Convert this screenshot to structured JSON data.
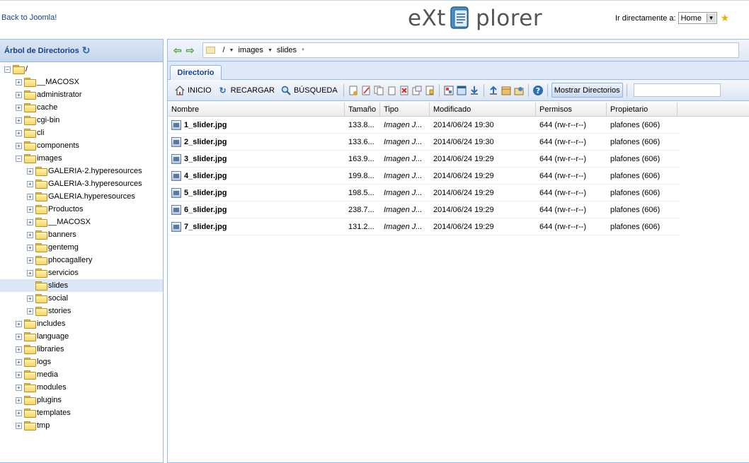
{
  "header": {
    "back_link": "Back to Joomla!",
    "logo_left": "eXt",
    "logo_right": "plorer",
    "jump_label": "Ir directamente a:",
    "jump_value": "Home"
  },
  "tree": {
    "title": "Árbol de Directorios",
    "root": "/",
    "nodes": [
      {
        "label": "__MACOSX",
        "level": 1,
        "expanded": false
      },
      {
        "label": "administrator",
        "level": 1,
        "expanded": false
      },
      {
        "label": "cache",
        "level": 1,
        "expanded": false
      },
      {
        "label": "cgi-bin",
        "level": 1,
        "expanded": false
      },
      {
        "label": "cli",
        "level": 1,
        "expanded": false
      },
      {
        "label": "components",
        "level": 1,
        "expanded": false
      },
      {
        "label": "images",
        "level": 1,
        "expanded": true
      },
      {
        "label": "GALERIA-2.hyperesources",
        "level": 2,
        "expanded": false
      },
      {
        "label": "GALERIA-3.hyperesources",
        "level": 2,
        "expanded": false
      },
      {
        "label": "GALERIA.hyperesources",
        "level": 2,
        "expanded": false
      },
      {
        "label": "Productos",
        "level": 2,
        "expanded": false
      },
      {
        "label": "__MACOSX",
        "level": 2,
        "expanded": false
      },
      {
        "label": "banners",
        "level": 2,
        "expanded": false
      },
      {
        "label": "gentemg",
        "level": 2,
        "expanded": false
      },
      {
        "label": "phocagallery",
        "level": 2,
        "expanded": false
      },
      {
        "label": "servicios",
        "level": 2,
        "expanded": false
      },
      {
        "label": "slides",
        "level": 2,
        "expanded": false,
        "leaf": true,
        "selected": true
      },
      {
        "label": "social",
        "level": 2,
        "expanded": false
      },
      {
        "label": "stories",
        "level": 2,
        "expanded": false
      },
      {
        "label": "includes",
        "level": 1,
        "expanded": false
      },
      {
        "label": "language",
        "level": 1,
        "expanded": false
      },
      {
        "label": "libraries",
        "level": 1,
        "expanded": false
      },
      {
        "label": "logs",
        "level": 1,
        "expanded": false
      },
      {
        "label": "media",
        "level": 1,
        "expanded": false
      },
      {
        "label": "modules",
        "level": 1,
        "expanded": false
      },
      {
        "label": "plugins",
        "level": 1,
        "expanded": false
      },
      {
        "label": "templates",
        "level": 1,
        "expanded": false
      },
      {
        "label": "tmp",
        "level": 1,
        "expanded": false
      }
    ]
  },
  "path": {
    "root": "/",
    "segments": [
      "images",
      "slides"
    ]
  },
  "tabs": {
    "directory": "Directorio"
  },
  "toolbar": {
    "home_label": "INICIO",
    "reload_label": "RECARGAR",
    "search_label": "BÚSQUEDA",
    "show_dirs_label": "Mostrar Directorios",
    "icons": [
      "new-file-icon",
      "edit-icon",
      "copy-icon",
      "move-icon",
      "delete-icon",
      "rename-icon",
      "chmod-icon",
      "view-icon",
      "download-icon",
      "upload-icon",
      "archive-icon",
      "extract-icon",
      "help-icon"
    ]
  },
  "grid": {
    "columns": [
      "Nombre",
      "Tamaño",
      "Tipo",
      "Modificado",
      "Permisos",
      "Propietario"
    ],
    "rows": [
      {
        "name": "1_slider.jpg",
        "size": "133.8...",
        "type": "Imagen J...",
        "modified": "2014/06/24 19:30",
        "perms": "644 (rw-r--r--)",
        "owner": "plafones (606)"
      },
      {
        "name": "2_slider.jpg",
        "size": "133.6...",
        "type": "Imagen J...",
        "modified": "2014/06/24 19:30",
        "perms": "644 (rw-r--r--)",
        "owner": "plafones (606)"
      },
      {
        "name": "3_slider.jpg",
        "size": "163.9...",
        "type": "Imagen J...",
        "modified": "2014/06/24 19:29",
        "perms": "644 (rw-r--r--)",
        "owner": "plafones (606)"
      },
      {
        "name": "4_slider.jpg",
        "size": "199.8...",
        "type": "Imagen J...",
        "modified": "2014/06/24 19:29",
        "perms": "644 (rw-r--r--)",
        "owner": "plafones (606)"
      },
      {
        "name": "5_slider.jpg",
        "size": "198.5...",
        "type": "Imagen J...",
        "modified": "2014/06/24 19:29",
        "perms": "644 (rw-r--r--)",
        "owner": "plafones (606)"
      },
      {
        "name": "6_slider.jpg",
        "size": "238.7...",
        "type": "Imagen J...",
        "modified": "2014/06/24 19:29",
        "perms": "644 (rw-r--r--)",
        "owner": "plafones (606)"
      },
      {
        "name": "7_slider.jpg",
        "size": "131.2...",
        "type": "Imagen J...",
        "modified": "2014/06/24 19:29",
        "perms": "644 (rw-r--r--)",
        "owner": "plafones (606)"
      }
    ]
  },
  "colors": {
    "accent": "#15428b",
    "panel_border": "#99bbe8",
    "selected_row": "#dde8f6"
  }
}
